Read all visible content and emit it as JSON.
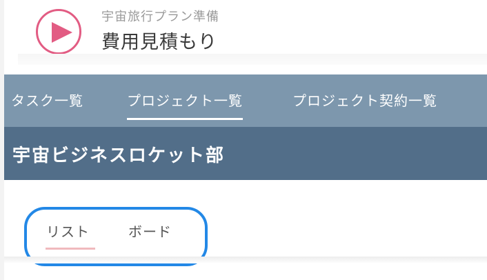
{
  "header": {
    "subtitle": "宇宙旅行プラン準備",
    "title": "費用見積もり"
  },
  "nav": {
    "items": [
      {
        "label": "タスク一覧",
        "active": false
      },
      {
        "label": "プロジェクト一覧",
        "active": true
      },
      {
        "label": "プロジェクト契約一覧",
        "active": false
      }
    ]
  },
  "department": {
    "title": "宇宙ビジネスロケット部"
  },
  "view_tabs": {
    "items": [
      {
        "label": "リスト",
        "active": true
      },
      {
        "label": "ボード",
        "active": false
      }
    ]
  },
  "colors": {
    "accent_pink": "#e25c83",
    "nav_bg": "#7d97ad",
    "dept_bg": "#526e89",
    "highlight_ring": "#2388e6",
    "active_tab_underline": "#f0b9bd"
  },
  "icons": {
    "play": "play-icon"
  }
}
